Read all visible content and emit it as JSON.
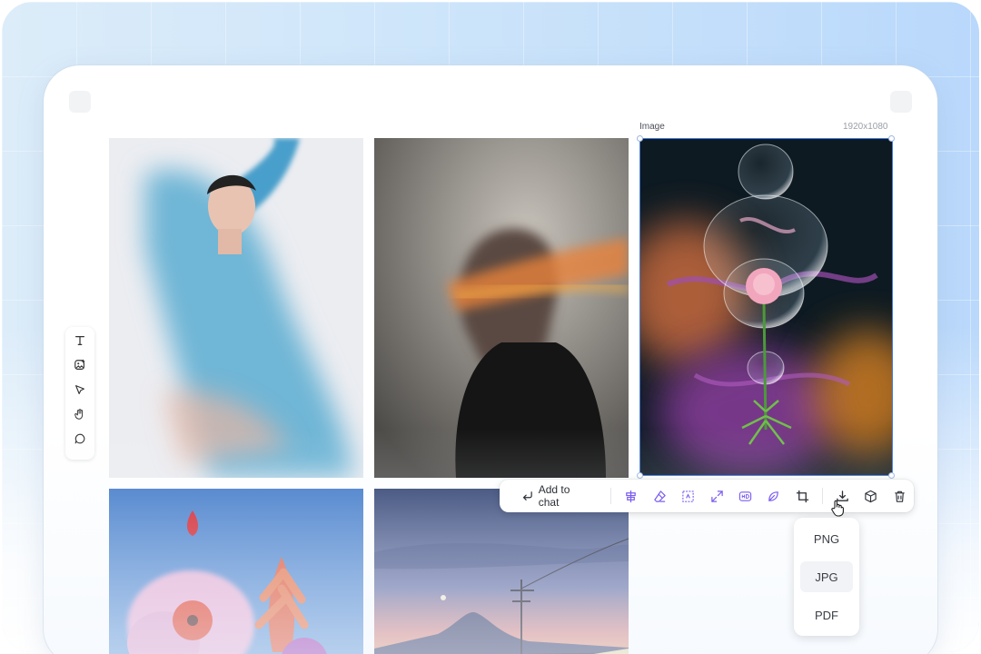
{
  "canvas": {
    "selected_image": {
      "label": "Image",
      "dimensions": "1920x1080"
    }
  },
  "left_toolbar": {
    "tools": [
      "text-tool-icon",
      "image-add-icon",
      "pointer-icon",
      "hand-icon",
      "comment-icon"
    ]
  },
  "image_toolbar": {
    "add_to_chat_label": "Add to chat",
    "tools": [
      "align-icon",
      "eraser-icon",
      "select-area-icon",
      "expand-icon",
      "hd-icon",
      "leaf-icon",
      "crop-icon",
      "download-icon",
      "cube-icon",
      "trash-icon"
    ]
  },
  "download_menu": {
    "options": [
      "PNG",
      "JPG",
      "PDF"
    ],
    "hovered": "JPG"
  },
  "colors": {
    "accent": "#3d7be6",
    "icon_purple": "#7b5cf0",
    "icon_dark": "#2b2f36"
  }
}
